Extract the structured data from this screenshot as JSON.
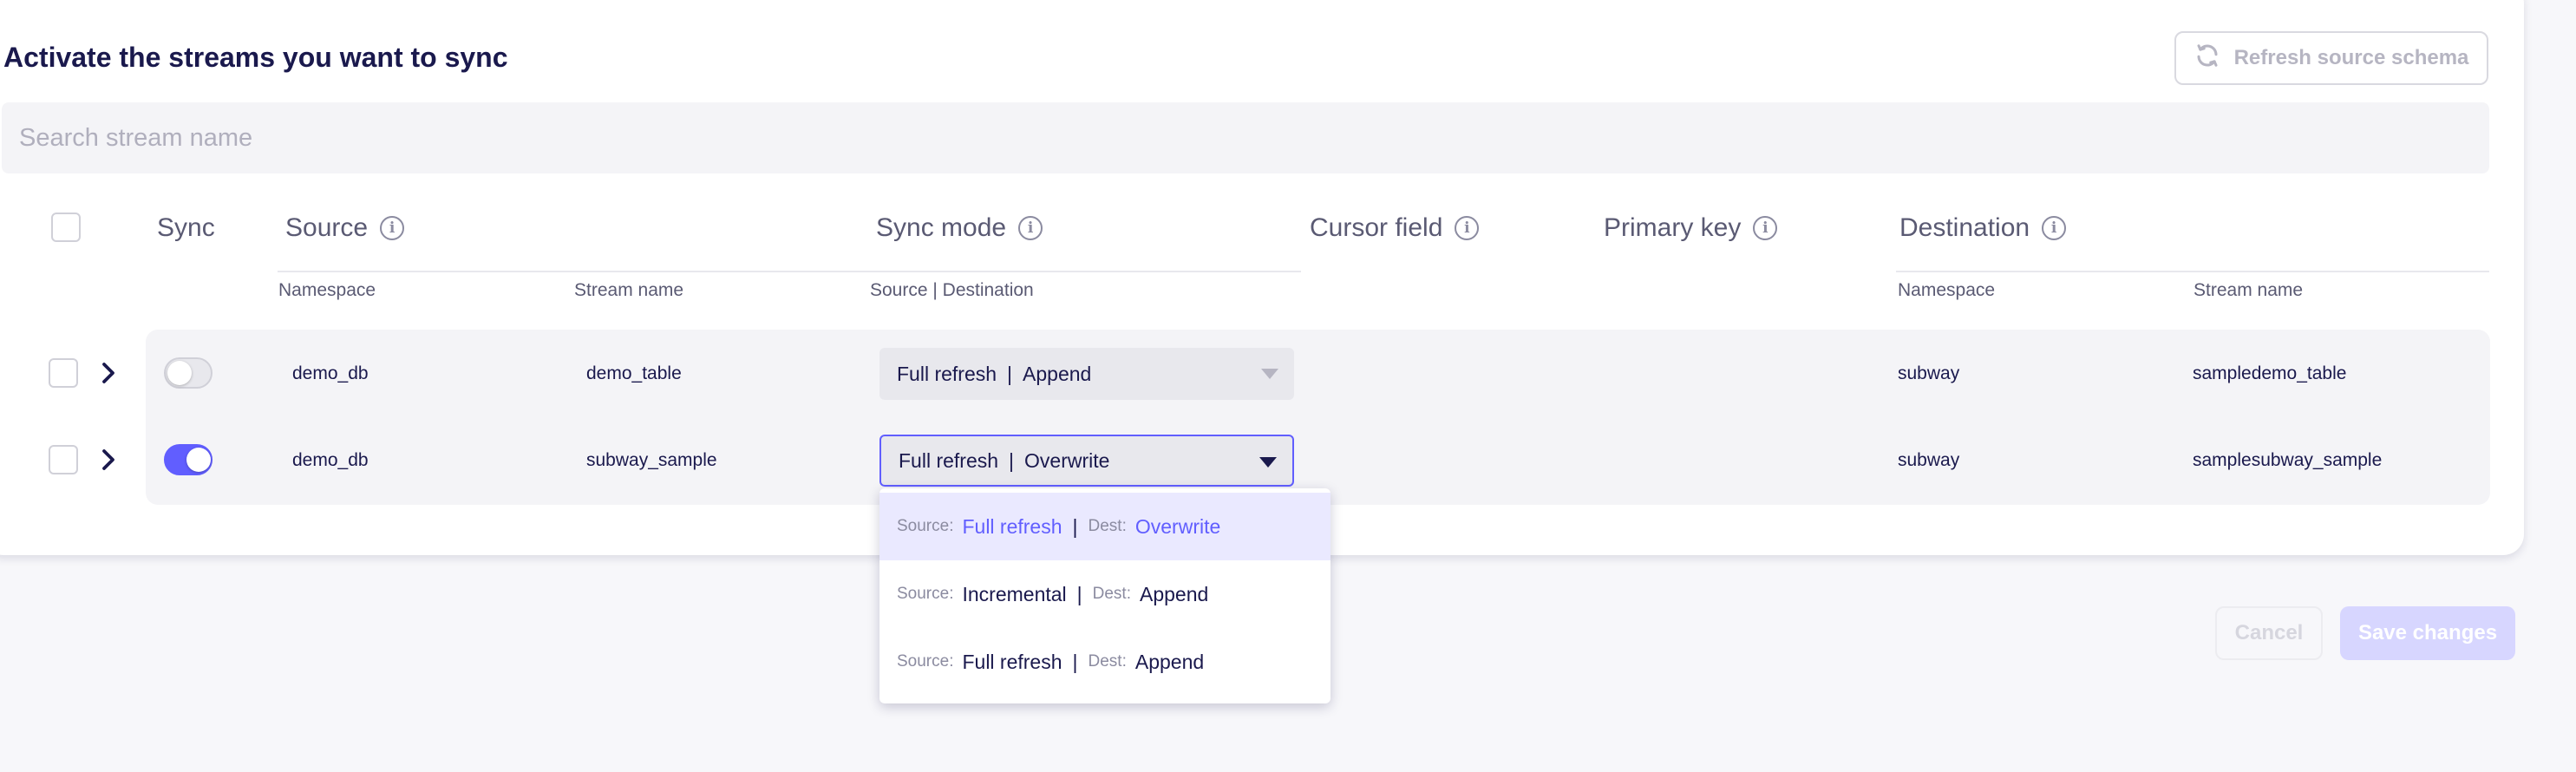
{
  "title": "Activate the streams you want to sync",
  "refresh_button": {
    "label": "Refresh source schema",
    "icon": "refresh-icon"
  },
  "search": {
    "placeholder": "Search stream name",
    "value": ""
  },
  "columns": {
    "sync": "Sync",
    "source": "Source",
    "sync_mode": "Sync mode",
    "cursor_field": "Cursor field",
    "primary_key": "Primary key",
    "destination": "Destination"
  },
  "subcolumns": {
    "source_namespace": "Namespace",
    "source_stream_name": "Stream name",
    "sync_mode": "Source | Destination",
    "dest_namespace": "Namespace",
    "dest_stream_name": "Stream name"
  },
  "rows": [
    {
      "checked": false,
      "sync_enabled": false,
      "source_namespace": "demo_db",
      "stream_name": "demo_table",
      "sync_source_mode": "Full refresh",
      "sync_dest_mode": "Append",
      "dest_namespace": "subway",
      "dest_stream_name": "sampledemo_table"
    },
    {
      "checked": false,
      "sync_enabled": true,
      "source_namespace": "demo_db",
      "stream_name": "subway_sample",
      "sync_source_mode": "Full refresh",
      "sync_dest_mode": "Overwrite",
      "dest_namespace": "subway",
      "dest_stream_name": "samplesubway_sample"
    }
  ],
  "dropdown_options": [
    {
      "source_label": "Source:",
      "source": "Full refresh",
      "dest_label": "Dest:",
      "dest": "Overwrite",
      "selected": true
    },
    {
      "source_label": "Source:",
      "source": "Incremental",
      "dest_label": "Dest:",
      "dest": "Append",
      "selected": false
    },
    {
      "source_label": "Source:",
      "source": "Full refresh",
      "dest_label": "Dest:",
      "dest": "Append",
      "selected": false
    }
  ],
  "separator": "|",
  "footer": {
    "cancel_label": "Cancel",
    "save_label": "Save changes"
  },
  "colors": {
    "accent": "#615eff",
    "text": "#1a194d",
    "muted": "#5a5a73",
    "disabled_button": "#d7d6ff"
  }
}
